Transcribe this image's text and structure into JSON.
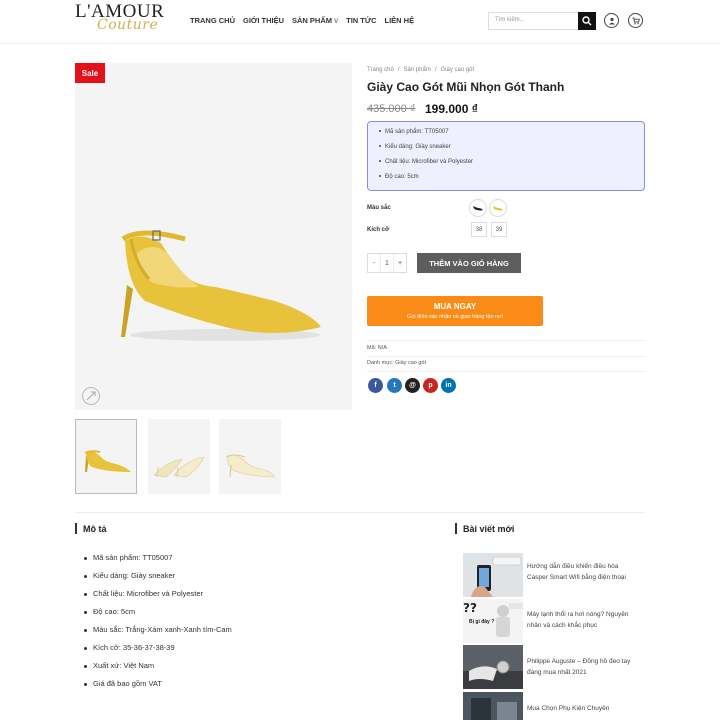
{
  "header": {
    "logo_main": "L'AMOUR",
    "logo_script": "Couture",
    "nav": [
      {
        "label": "TRANG CHỦ"
      },
      {
        "label": "GIỚI THIỆU"
      },
      {
        "label": "SẢN PHẨM",
        "chevron": "v"
      },
      {
        "label": "TIN TỨC"
      },
      {
        "label": "LIÊN HỆ"
      }
    ],
    "search_placeholder": "Tìm kiếm...",
    "icons": [
      "search-icon",
      "user-icon",
      "cart-icon"
    ]
  },
  "gallery": {
    "sale_badge": "Sale",
    "product_color": "#e8c23b",
    "thumbnails": [
      "yellow-heel",
      "cream-heel",
      "cream-heel-side"
    ]
  },
  "product": {
    "breadcrumb": [
      "Trang chủ",
      "/",
      "Sản phẩm",
      "/",
      "Giày cao gót"
    ],
    "title": "Giày Cao Gót Mũi Nhọn Gót Thanh",
    "price_old": "435.000 ₫",
    "price_new": "199.000 ₫",
    "specs": [
      "Mã sản phẩm: TT05007",
      "Kiểu dáng: Giày sneaker",
      "Chất liệu: Microfiber và Polyester",
      "Độ cao: 5cm"
    ],
    "color_label": "Màu sắc",
    "size_label": "Kích cỡ",
    "sizes": [
      "38",
      "39"
    ],
    "qty_minus": "-",
    "qty_value": "1",
    "qty_plus": "+",
    "add_to_cart": "THÊM VÀO GIỎ HÀNG",
    "buy_now": "MUA NGAY",
    "buy_now_sub": "Gọi điện xác nhận và giao hàng tận nơi",
    "sku": "Mã: N/A",
    "category": "Danh mục: Giày cao gót",
    "share": [
      {
        "name": "facebook",
        "glyph": "f",
        "color": "#3a589d"
      },
      {
        "name": "twitter",
        "glyph": "t",
        "color": "#2478ba"
      },
      {
        "name": "email",
        "glyph": "@",
        "color": "#222222"
      },
      {
        "name": "pinterest",
        "glyph": "p",
        "color": "#cb2320"
      },
      {
        "name": "linkedin",
        "glyph": "in",
        "color": "#0072b7"
      }
    ]
  },
  "description": {
    "title": "Mô tả",
    "items": [
      "Mã sản phẩm: TT05007",
      "Kiểu dáng: Giày sneaker",
      "Chất liệu: Microfiber và Polyester",
      "Độ cao: 5cm",
      "Màu sắc: Trắng-Xám xanh-Xanh tím-Cam",
      "Kích cỡ: 35-36-37-38-39",
      "Xuất xứ: Việt Nam",
      "Giá đã bao gồm VAT"
    ]
  },
  "recent_posts": {
    "title": "Bài viết mới",
    "items": [
      "Hướng dẫn điều khiển điều hòa Casper Smart Wifi bằng điện thoại",
      "Máy lạnh thổi ra hơi nóng? Nguyên nhân và cách khắc phục",
      "Philippe Auguste – Đồng hồ đeo tay đáng mua nhất 2021",
      "Mua Chọn Phụ Kiện Chuyên"
    ],
    "thumb_text": "Bị gì đây ?"
  }
}
